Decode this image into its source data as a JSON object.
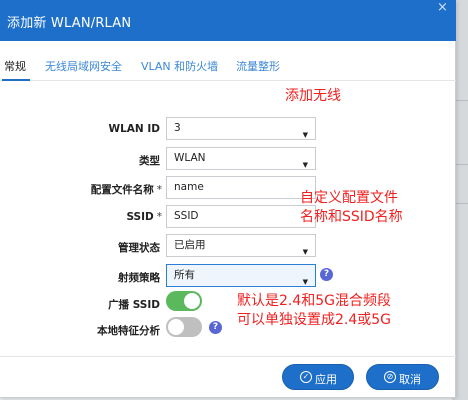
{
  "dialog": {
    "title": "添加新 WLAN/RLAN",
    "close_glyph": "×"
  },
  "tabs": [
    {
      "label": "常规"
    },
    {
      "label": "无线局域网安全"
    },
    {
      "label": "VLAN 和防火墙"
    },
    {
      "label": "流量整形"
    }
  ],
  "active_tab": 0,
  "annotations": {
    "add_wireless": "添加无线",
    "custom_profile_line1": "自定义配置文件",
    "custom_profile_line2": "名称和SSID名称",
    "default_band_line1": "默认是2.4和5G混合频段",
    "default_band_line2": "可以单独设置成2.4或5G"
  },
  "form": {
    "wlan_id": {
      "label": "WLAN ID",
      "value": "3"
    },
    "type": {
      "label": "类型",
      "value": "WLAN"
    },
    "profile_name": {
      "label": "配置文件名称",
      "required_mark": "*",
      "value": "name"
    },
    "ssid": {
      "label": "SSID",
      "required_mark": "*",
      "value": "SSID"
    },
    "admin_state": {
      "label": "管理状态",
      "value": "已启用"
    },
    "radio_policy": {
      "label": "射频策略",
      "value": "所有"
    },
    "broadcast_ssid": {
      "label": "广播 SSID",
      "enabled": true
    },
    "local_profiling": {
      "label": "本地特征分析",
      "enabled": false
    }
  },
  "buttons": {
    "apply": {
      "label": "应用",
      "icon": "check-circle-icon"
    },
    "cancel": {
      "label": "取消",
      "icon": "ban-circle-icon"
    }
  },
  "colors": {
    "header": "#1e6fc9",
    "annotation": "#f02020",
    "toggle_on": "#5cb85c",
    "toggle_off": "#bfbfbf",
    "help_icon": "#5866d6"
  }
}
